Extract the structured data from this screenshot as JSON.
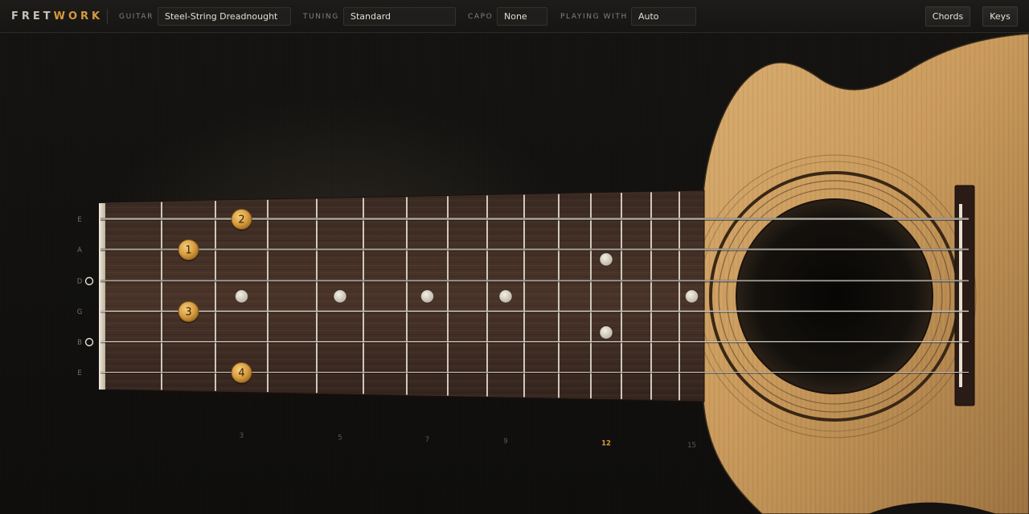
{
  "app": {
    "brand_main": "FRET",
    "brand_accent": "WORK",
    "accent_color": "#d99a3c"
  },
  "toolbar": {
    "guitar_label": "GUITAR",
    "guitar_value": "Steel-String Dreadnought",
    "tuning_label": "TUNING",
    "tuning_value": "Standard",
    "capo_label": "CAPO",
    "capo_value": "None",
    "playing_label": "PLAYING WITH",
    "playing_value": "Auto",
    "chords_button": "Chords",
    "keys_button": "Keys"
  },
  "fretboard": {
    "strings": [
      {
        "label": "E",
        "open": false
      },
      {
        "label": "A",
        "open": false
      },
      {
        "label": "D",
        "open": true
      },
      {
        "label": "G",
        "open": false
      },
      {
        "label": "B",
        "open": true
      },
      {
        "label": "E",
        "open": false
      }
    ],
    "fret_count": 15,
    "inlay_frets": [
      3,
      5,
      7,
      9,
      12,
      15
    ],
    "double_inlay_fret": 12,
    "fret_numbers": [
      {
        "number": "3",
        "fret": 3,
        "highlight": false
      },
      {
        "number": "5",
        "fret": 5,
        "highlight": false
      },
      {
        "number": "7",
        "fret": 7,
        "highlight": false
      },
      {
        "number": "9",
        "fret": 9,
        "highlight": false
      },
      {
        "number": "12",
        "fret": 12,
        "highlight": true
      },
      {
        "number": "15",
        "fret": 15,
        "highlight": false
      }
    ],
    "finger_markers": [
      {
        "finger": "2",
        "string": 0,
        "fret": 3
      },
      {
        "finger": "1",
        "string": 1,
        "fret": 2
      },
      {
        "finger": "3",
        "string": 3,
        "fret": 2
      },
      {
        "finger": "4",
        "string": 5,
        "fret": 3
      }
    ]
  }
}
